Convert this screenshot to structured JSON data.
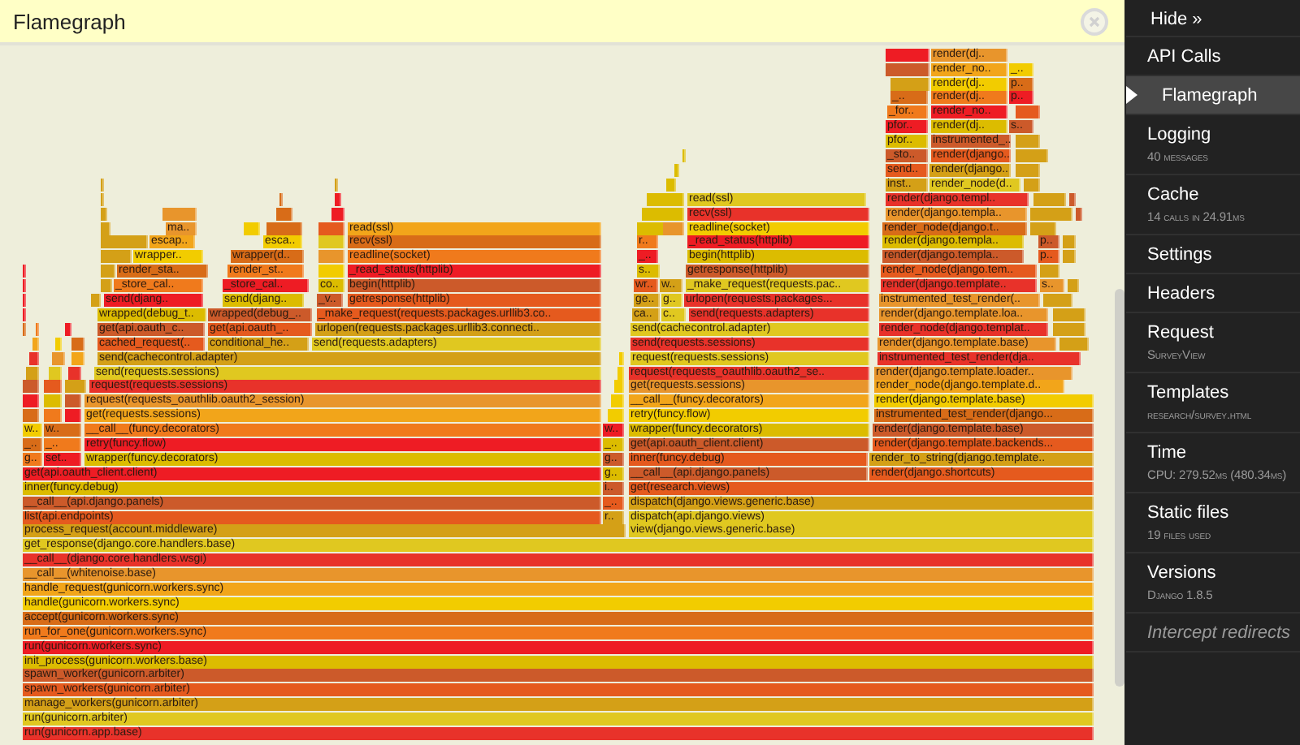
{
  "panel": {
    "title": "Flamegraph"
  },
  "flamegraph": {
    "frames": [
      "render(dj..",
      "render_no..",
      "_..",
      "render(dj..",
      "p..",
      "_..",
      "render(dj..",
      "p..",
      "_for..",
      "render_no..",
      "pfor..",
      "render(dj..",
      "s..",
      "pfor..",
      "instrumented_..",
      "_sto..",
      "render(django..",
      "send..",
      "render(django..",
      "inst..",
      "render_node(d..",
      "read(ssl)",
      "render(django.templ..",
      "recv(ssl)",
      "render(django.templa..",
      "ma..",
      "read(ssl)",
      "readline(socket)",
      "render_node(django.t..",
      "escap..",
      "esca..",
      "recv(ssl)",
      "r..",
      "_read_status(httplib)",
      "render(django.templa..",
      "p..",
      "wrapper..",
      "wrapper(d..",
      "readline(socket)",
      "_..",
      "begin(httplib)",
      "render(django.templa..",
      "p..",
      "render_sta..",
      "render_st..",
      "_read_status(httplib)",
      "s..",
      "getresponse(httplib)",
      "render_node(django.tem..",
      "_store_cal..",
      "_store_cal..",
      "co..",
      "begin(httplib)",
      "wr..",
      "w..",
      "_make_request(requests.pac..",
      "render(django.template..",
      "s..",
      "send(djang..",
      "send(djang..",
      "_v..",
      "getresponse(httplib)",
      "ge..",
      "g..",
      "urlopen(requests.packages...",
      "instrumented_test_render(..",
      "wrapped(debug_t..",
      "wrapped(debug_..",
      "_make_request(requests.packages.urllib3.co..",
      "ca..",
      "c..",
      "send(requests.adapters)",
      "render(django.template.loa..",
      "get(api.oauth_c..",
      "get(api.oauth_..",
      "urlopen(requests.packages.urllib3.connecti..",
      "send(cachecontrol.adapter)",
      "render_node(django.templat..",
      "cached_request(..",
      "conditional_he..",
      "send(requests.adapters)",
      "send(requests.sessions)",
      "render(django.template.base)",
      "send(cachecontrol.adapter)",
      "request(requests.sessions)",
      "instrumented_test_render(dja..",
      "send(requests.sessions)",
      "request(requests_oauthlib.oauth2_se..",
      "render(django.template.loader..",
      "request(requests.sessions)",
      "get(requests.sessions)",
      "render_node(django.template.d..",
      "request(requests_oauthlib.oauth2_session)",
      "__call__(funcy.decorators)",
      "render(django.template.base)",
      "get(requests.sessions)",
      "retry(funcy.flow)",
      "instrumented_test_render(django...",
      "w..",
      "w..",
      "__call__(funcy.decorators)",
      "w..",
      "wrapper(funcy.decorators)",
      "render(django.template.base)",
      "_..",
      "_..",
      "retry(funcy.flow)",
      "_..",
      "get(api.oauth_client.client)",
      "render(django.template.backends...",
      "g..",
      "set..",
      "wrapper(funcy.decorators)",
      "g..",
      "inner(funcy.debug)",
      "render_to_string(django.template..",
      "get(api.oauth_client.client)",
      "g..",
      "__call__(api.django.panels)",
      "render(django.shortcuts)",
      "inner(funcy.debug)",
      "i..",
      "get(research.views)",
      "__call__(api.django.panels)",
      "_..",
      "dispatch(django.views.generic.base)",
      "list(api.endpoints)",
      "r..",
      "dispatch(api.django.views)",
      "process_request(account.middleware)",
      "view(django.views.generic.base)",
      "get_response(django.core.handlers.base)",
      "__call__(django.core.handlers.wsgi)",
      "__call__(whitenoise.base)",
      "handle_request(gunicorn.workers.sync)",
      "handle(gunicorn.workers.sync)",
      "accept(gunicorn.workers.sync)",
      "run_for_one(gunicorn.workers.sync)",
      "run(gunicorn.workers.sync)",
      "init_process(gunicorn.workers.base)",
      "spawn_worker(gunicorn.arbiter)",
      "spawn_workers(gunicorn.arbiter)",
      "manage_workers(gunicorn.arbiter)",
      "run(gunicorn.arbiter)",
      "run(gunicorn.app.base)"
    ]
  },
  "sidebar": {
    "hide_label": "Hide »",
    "items": [
      {
        "label": "API Calls",
        "selected": false,
        "kind": "panel"
      },
      {
        "label": "Flamegraph",
        "selected": true,
        "kind": "panel"
      },
      {
        "label": "Logging",
        "subtitle": "40 messages",
        "selected": false,
        "kind": "panel"
      },
      {
        "label": "Cache",
        "subtitle": "14 calls in 24.91ms",
        "selected": false,
        "kind": "panel"
      },
      {
        "label": "Settings",
        "selected": false,
        "kind": "panel"
      },
      {
        "label": "Headers",
        "selected": false,
        "kind": "panel"
      },
      {
        "label": "Request",
        "subtitle": "SurveyView",
        "selected": false,
        "kind": "panel"
      },
      {
        "label": "Templates",
        "subtitle": "research/survey.html",
        "selected": false,
        "kind": "panel"
      },
      {
        "label": "Time",
        "subtitle": "CPU: 279.52ms (480.34ms)",
        "selected": false,
        "kind": "panel"
      },
      {
        "label": "Static files",
        "subtitle": "19 files used",
        "selected": false,
        "kind": "panel"
      },
      {
        "label": "Versions",
        "subtitle": "Django 1.8.5",
        "selected": false,
        "kind": "panel"
      },
      {
        "label": "Intercept redirects",
        "selected": false,
        "kind": "toggle"
      }
    ]
  }
}
